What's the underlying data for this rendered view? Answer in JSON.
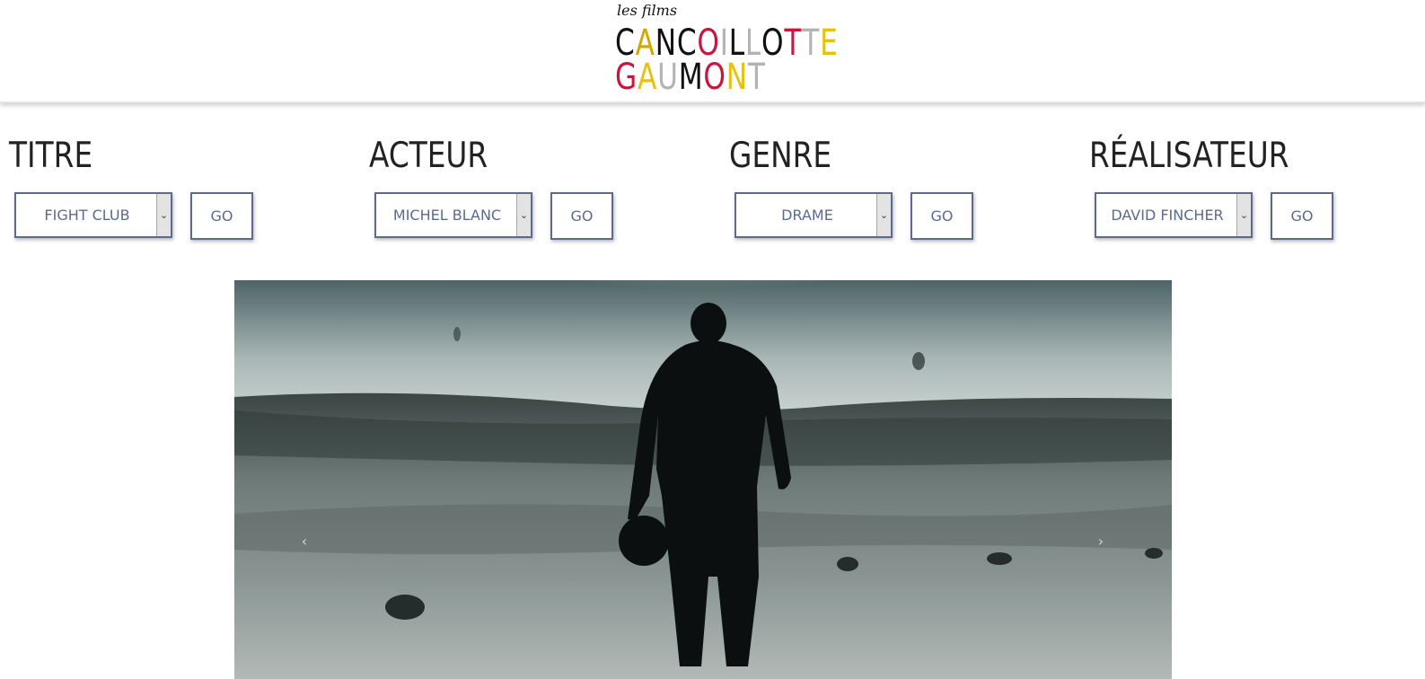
{
  "logo": {
    "top_text": "les films",
    "line1": "CANCOILLOTTE",
    "line2": "GAUMONT",
    "line1_colors": [
      "#111111",
      "#d4a600",
      "#111111",
      "#111111",
      "#c9163f",
      "#b3b3b3",
      "#111111",
      "#b3b3b3",
      "#111111",
      "#c9163f",
      "#b3b3b3",
      "#e8c10f"
    ],
    "line2_colors": [
      "#c9163f",
      "#e8c10f",
      "#b3b3b3",
      "#111111",
      "#c9163f",
      "#e8c10f",
      "#b3b3b3"
    ]
  },
  "filters": [
    {
      "title": "TITRE",
      "selected": "FIGHT CLUB",
      "button": "GO"
    },
    {
      "title": "ACTEUR",
      "selected": "MICHEL BLANC",
      "button": "GO"
    },
    {
      "title": "GENRE",
      "selected": "DRAME",
      "button": "GO"
    },
    {
      "title": "RÉALISATEUR",
      "selected": "DAVID FINCHER",
      "button": "GO"
    }
  ],
  "carousel": {
    "prev_icon": "chevron-left-icon",
    "next_icon": "chevron-right-icon",
    "prev_glyph": "‹",
    "next_glyph": "›"
  },
  "colors": {
    "accent": "#5c6a8f",
    "logo_red": "#c9163f",
    "logo_yellow": "#e8c10f",
    "logo_gray": "#b3b3b3"
  }
}
